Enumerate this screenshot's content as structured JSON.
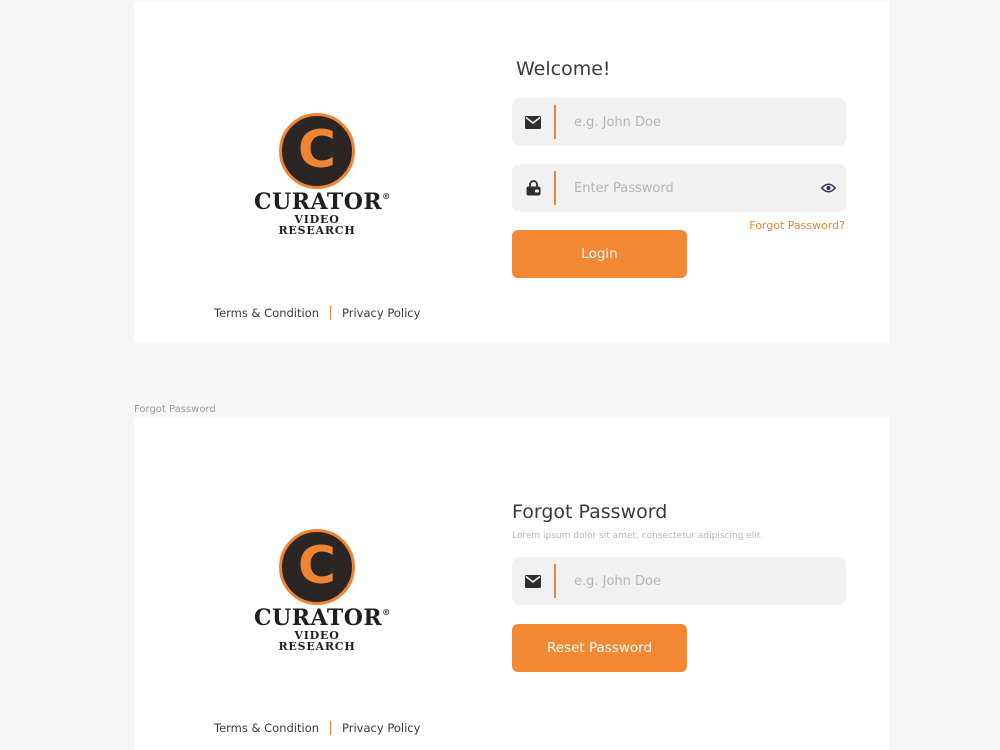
{
  "login": {
    "title": "Welcome!",
    "email_placeholder": "e.g. John Doe",
    "password_placeholder": "Enter Password",
    "forgot_link": "Forgot Password?",
    "login_button": "Login"
  },
  "forgot": {
    "frame_label": "Forgot Password",
    "title": "Forgot Password",
    "subtitle": "Lorem ipsum dolor sit amet, consectetur adipiscing elit.",
    "email_placeholder": "e.g. John Doe",
    "reset_button": "Reset Password"
  },
  "brand": {
    "letter": "C",
    "name": "CURATOR",
    "registered": "®",
    "tagline": "VIDEO RESEARCH",
    "accent_color": "#ef8432",
    "dark_color": "#2b2624"
  },
  "footer": {
    "terms": "Terms & Condition",
    "privacy": "Privacy Policy"
  },
  "icons": {
    "email": "envelope-icon",
    "password": "lock-icon",
    "toggle_visibility": "eye-icon"
  }
}
